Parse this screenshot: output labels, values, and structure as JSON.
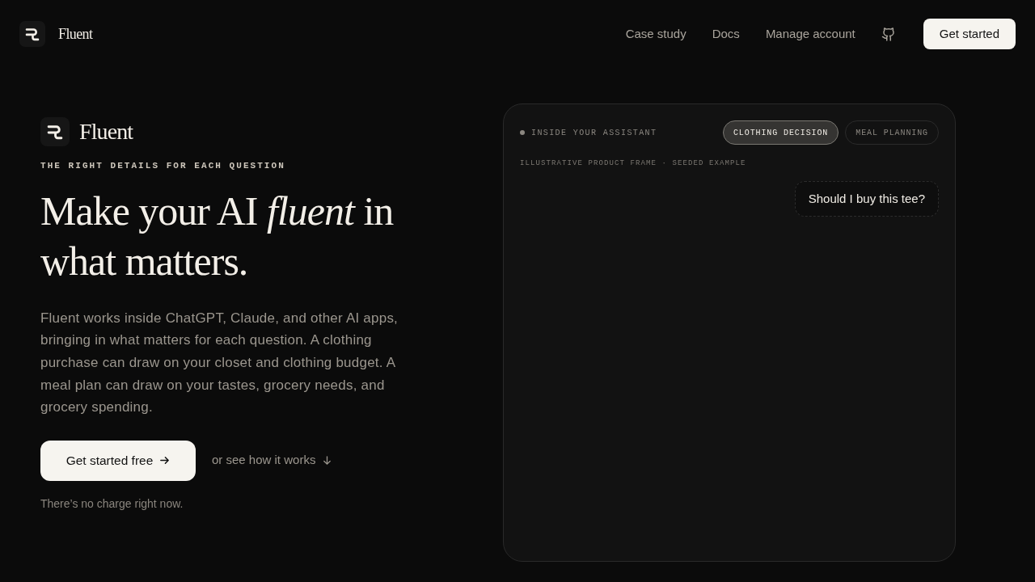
{
  "nav": {
    "brand": "Fluent",
    "links": [
      "Case study",
      "Docs",
      "Manage account"
    ],
    "cta": "Get started"
  },
  "hero": {
    "brand": "Fluent",
    "eyebrow": "THE RIGHT DETAILS FOR EACH QUESTION",
    "headline": "Make your AI *fluent* in what matters.",
    "body": "Fluent works inside ChatGPT, Claude, and other AI apps, bringing in what matters for each question. A clothing purchase can draw on your closet and clothing budget. A meal plan can draw on your tastes, grocery needs, and grocery spending.",
    "primary_button": "Get started free",
    "secondary_link": "or see how it works",
    "note": "There’s no charge right now."
  },
  "frame": {
    "label": "INSIDE YOUR ASSISTANT",
    "tabs": [
      {
        "label": "CLOTHING DECISION",
        "selected": true
      },
      {
        "label": "MEAL PLANNING",
        "selected": false
      }
    ],
    "caption": "ILLUSTRATIVE PRODUCT FRAME · SEEDED EXAMPLE",
    "messages": [
      {
        "text": "Should I buy this tee?"
      }
    ]
  }
}
